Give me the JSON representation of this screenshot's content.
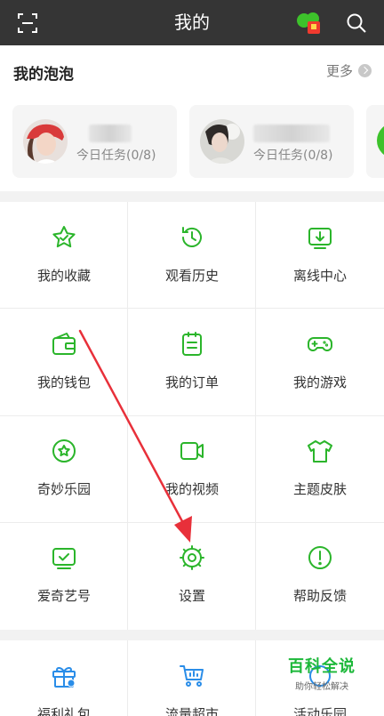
{
  "topbar": {
    "title": "我的"
  },
  "bubbles": {
    "title": "我的泡泡",
    "more": "更多",
    "cards": [
      {
        "task": "今日任务(0/8)"
      },
      {
        "task": "今日任务(0/8)"
      }
    ]
  },
  "grid": {
    "items": [
      {
        "label": "我的收藏",
        "icon": "star-icon"
      },
      {
        "label": "观看历史",
        "icon": "history-clock-icon"
      },
      {
        "label": "离线中心",
        "icon": "download-icon"
      },
      {
        "label": "我的钱包",
        "icon": "wallet-icon"
      },
      {
        "label": "我的订单",
        "icon": "order-clipboard-icon"
      },
      {
        "label": "我的游戏",
        "icon": "gamepad-icon"
      },
      {
        "label": "奇妙乐园",
        "icon": "badge-star-icon"
      },
      {
        "label": "我的视频",
        "icon": "video-camera-icon"
      },
      {
        "label": "主题皮肤",
        "icon": "tshirt-icon"
      },
      {
        "label": "爱奇艺号",
        "icon": "tv-check-icon"
      },
      {
        "label": "设置",
        "icon": "settings-gear-icon"
      },
      {
        "label": "帮助反馈",
        "icon": "help-exclaim-icon"
      }
    ]
  },
  "bottom": {
    "items": [
      {
        "label": "福利礼包",
        "icon": "gift-icon"
      },
      {
        "label": "流量超市",
        "icon": "cart-icon"
      },
      {
        "label": "活动乐园",
        "icon": "activity-icon"
      }
    ]
  },
  "watermark": {
    "title": "百科全说",
    "subtitle": "助你轻松解决"
  },
  "colors": {
    "topbar": "#353535",
    "accent": "#2bb52b",
    "annotation_arrow": "#e8303a"
  }
}
